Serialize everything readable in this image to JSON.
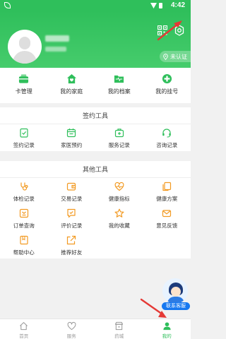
{
  "status_bar": {
    "time": "4:42"
  },
  "profile": {
    "verify_label": "未认证"
  },
  "quick_actions": [
    {
      "label": "卡管理",
      "icon": "card-wallet-icon"
    },
    {
      "label": "我的家庭",
      "icon": "home-heart-icon"
    },
    {
      "label": "我的档案",
      "icon": "folder-icon"
    },
    {
      "label": "我的挂号",
      "icon": "medical-cross-icon"
    }
  ],
  "sign_tools": {
    "title": "签约工具",
    "items": [
      {
        "label": "签约记录",
        "icon": "contract-check-icon"
      },
      {
        "label": "家医预约",
        "icon": "calendar-icon"
      },
      {
        "label": "服务记录",
        "icon": "medical-kit-icon"
      },
      {
        "label": "咨询记录",
        "icon": "headset-icon"
      }
    ]
  },
  "other_tools": {
    "title": "其他工具",
    "items": [
      {
        "label": "体检记录",
        "icon": "stethoscope-icon"
      },
      {
        "label": "交易记录",
        "icon": "wallet-icon"
      },
      {
        "label": "健康指标",
        "icon": "heart-pulse-icon"
      },
      {
        "label": "健康方案",
        "icon": "document-copy-icon"
      },
      {
        "label": "订单查询",
        "icon": "order-icon"
      },
      {
        "label": "评价记录",
        "icon": "review-icon"
      },
      {
        "label": "我的收藏",
        "icon": "star-icon"
      },
      {
        "label": "意见反馈",
        "icon": "mail-icon"
      },
      {
        "label": "帮助中心",
        "icon": "book-icon"
      },
      {
        "label": "推荐好友",
        "icon": "share-icon"
      }
    ]
  },
  "contact_service": {
    "label": "联系客服"
  },
  "tab_bar": [
    {
      "label": "首页",
      "icon": "home-icon",
      "active": false
    },
    {
      "label": "服务",
      "icon": "heart-icon",
      "active": false
    },
    {
      "label": "药城",
      "icon": "store-icon",
      "active": false
    },
    {
      "label": "我的",
      "icon": "user-icon",
      "active": true
    }
  ],
  "colors": {
    "brand_green": "#2fbf5b",
    "accent_orange": "#f29a22",
    "annotation_red": "#e53935",
    "service_blue": "#1778f0"
  }
}
